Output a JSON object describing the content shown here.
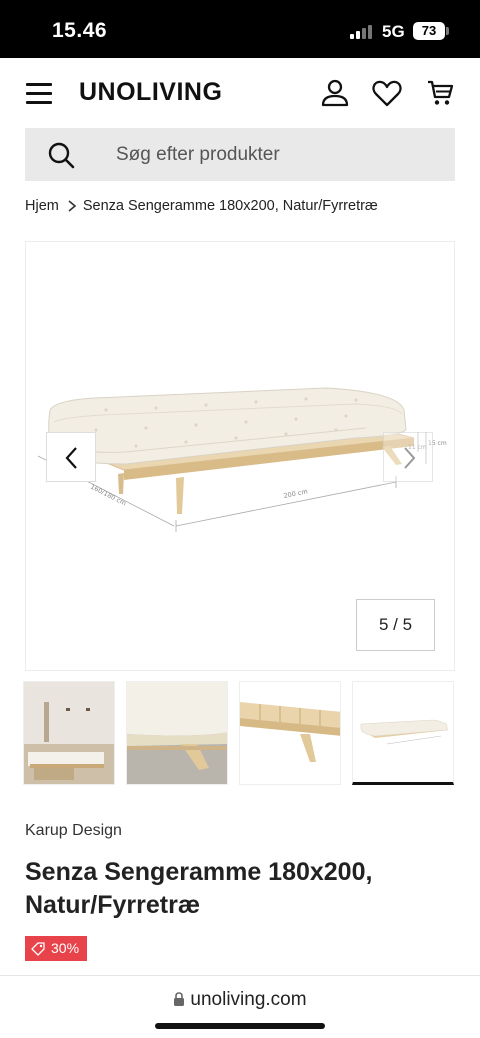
{
  "status_bar": {
    "time": "15.46",
    "network": "5G",
    "battery": "73"
  },
  "header": {
    "brand": "UNOLIVING"
  },
  "search": {
    "placeholder": "Søg efter produkter"
  },
  "breadcrumb": {
    "home": "Hjem",
    "current": "Senza Sengeramme 180x200, Natur/Fyrretræ"
  },
  "gallery": {
    "counter": "5 / 5",
    "current_index": 5,
    "total": 5,
    "dimension_labels": {
      "length": "200 cm",
      "width": "160/180 cm",
      "frame_height": "15 cm",
      "mattress_height": "11 cm"
    }
  },
  "product": {
    "brand": "Karup Design",
    "title": "Senza Sengeramme 180x200, Natur/Fyrretræ",
    "discount": "30%"
  },
  "browser": {
    "url": "unoliving.com"
  },
  "colors": {
    "discount": "#e8434a",
    "search_bg": "#e9e9e9",
    "wood": "#e6cfa6",
    "mattress": "#f1ede3"
  },
  "icons": [
    "menu-icon",
    "user-icon",
    "heart-icon",
    "cart-icon",
    "search-icon",
    "chevron-right-icon",
    "chevron-left-icon",
    "tag-icon",
    "lock-icon"
  ]
}
